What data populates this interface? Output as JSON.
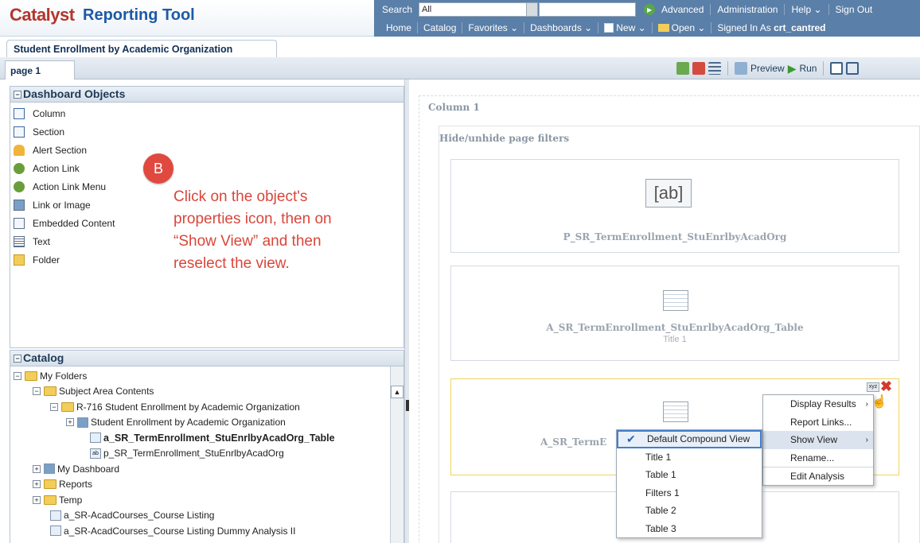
{
  "header": {
    "logo": "Catalyst",
    "app_title": "Reporting Tool",
    "search_label": "Search",
    "search_scope": "All",
    "links": [
      "Advanced",
      "Administration",
      "Help ⌄",
      "Sign Out"
    ]
  },
  "subnav": {
    "links": [
      "Home",
      "Catalog",
      "Favorites ⌄",
      "Dashboards ⌄",
      "New ⌄",
      "Open ⌄"
    ],
    "signed_in_label": "Signed In As",
    "signed_in_user": "crt_cantred"
  },
  "dashboard_tab": "Student Enrollment by Academic Organization",
  "page_tab": "page 1",
  "toolbar": {
    "preview": "Preview",
    "run": "Run"
  },
  "dashboard_objects": {
    "title": "Dashboard Objects",
    "items": [
      "Column",
      "Section",
      "Alert Section",
      "Action Link",
      "Action Link Menu",
      "Link or Image",
      "Embedded Content",
      "Text",
      "Folder"
    ]
  },
  "callout": {
    "badge": "B",
    "text": "Click on the object's properties icon, then on “Show View” and then reselect the view."
  },
  "catalog": {
    "title": "Catalog",
    "items": [
      "My Folders",
      "Subject Area Contents",
      "R-716 Student Enrollment by Academic Organization",
      "Student Enrollment by Academic Organization",
      "a_SR_TermEnrollment_StuEnrlbyAcadOrg_Table",
      "p_SR_TermEnrollment_StuEnrlbyAcadOrg",
      "My Dashboard",
      "Reports",
      "Temp",
      "a_SR-AcadCourses_Course Listing",
      "a_SR-AcadCourses_Course Listing Dummy Analysis II"
    ]
  },
  "canvas": {
    "column_title": "Column 1",
    "section_title": "Hide/unhide page filters",
    "prompt_view": "P_SR_TermEnrollment_StuEnrlbyAcadOrg",
    "prompt_icon_text": "[ab]",
    "table_view": "A_SR_TermEnrollment_StuEnrlbyAcadOrg_Table",
    "table_view_sub": "Title 1",
    "selected_view_partial": "A_SR_TermE"
  },
  "properties_menu": [
    "Display Results",
    "Report Links...",
    "Show View",
    "Rename...",
    "Edit Analysis"
  ],
  "view_submenu": [
    "Default Compound View",
    "Title 1",
    "Table 1",
    "Filters 1",
    "Table 2",
    "Table 3"
  ],
  "colors": {
    "brand_red": "#b3362b",
    "brand_blue": "#1c5aa6",
    "nav_blue": "#5a7fa8",
    "callout_red": "#d9463a"
  }
}
